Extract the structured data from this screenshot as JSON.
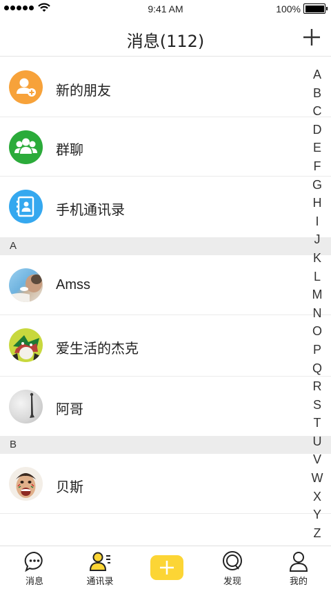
{
  "status_bar": {
    "time": "9:41 AM",
    "battery": "100%"
  },
  "header": {
    "title": "消息(112)"
  },
  "special_rows": [
    {
      "label": "新的朋友",
      "icon": "new-friend-icon",
      "color": "#f7a23a"
    },
    {
      "label": "群聊",
      "icon": "group-chat-icon",
      "color": "#2bab3a"
    },
    {
      "label": "手机通讯录",
      "icon": "phone-contacts-icon",
      "color": "#35a8ef"
    }
  ],
  "sections": [
    {
      "letter": "A",
      "contacts": [
        "Amss",
        "爱生活的杰克",
        "阿哥"
      ]
    },
    {
      "letter": "B",
      "contacts": [
        "贝斯"
      ]
    }
  ],
  "index_letters": [
    "A",
    "B",
    "C",
    "D",
    "E",
    "F",
    "G",
    "H",
    "I",
    "J",
    "K",
    "L",
    "M",
    "N",
    "O",
    "P",
    "Q",
    "R",
    "S",
    "T",
    "U",
    "V",
    "W",
    "X",
    "Y",
    "Z"
  ],
  "tabs": [
    {
      "label": "消息",
      "icon": "message-icon"
    },
    {
      "label": "通讯录",
      "icon": "contacts-icon"
    },
    {
      "label": "发现",
      "icon": "discover-icon"
    },
    {
      "label": "我的",
      "icon": "profile-icon"
    }
  ],
  "colors": {
    "accent": "#fcd535"
  }
}
